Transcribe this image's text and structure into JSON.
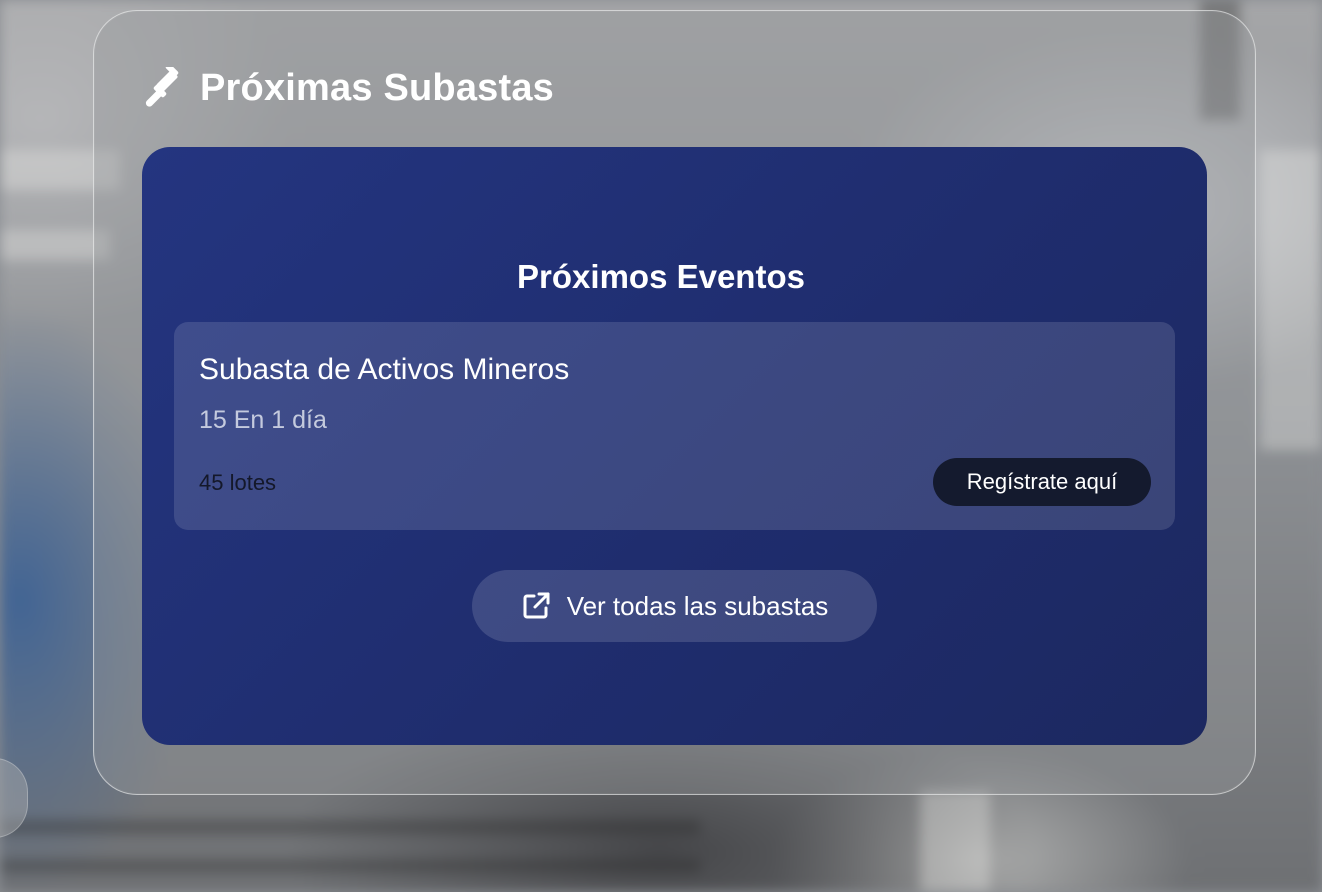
{
  "panel": {
    "title": "Próximas Subastas",
    "icon": "gavel-icon"
  },
  "events": {
    "heading": "Próximos Eventos",
    "items": [
      {
        "title": "Subasta de Activos Mineros",
        "date": "15 En 1 día",
        "lots": "45 lotes",
        "register_label": "Regístrate aquí"
      }
    ],
    "view_all_label": "Ver todas las subastas",
    "view_all_icon": "external-link-icon"
  },
  "colors": {
    "card_background": "#243580",
    "register_button": "#141a2e",
    "text": "#ffffff"
  }
}
